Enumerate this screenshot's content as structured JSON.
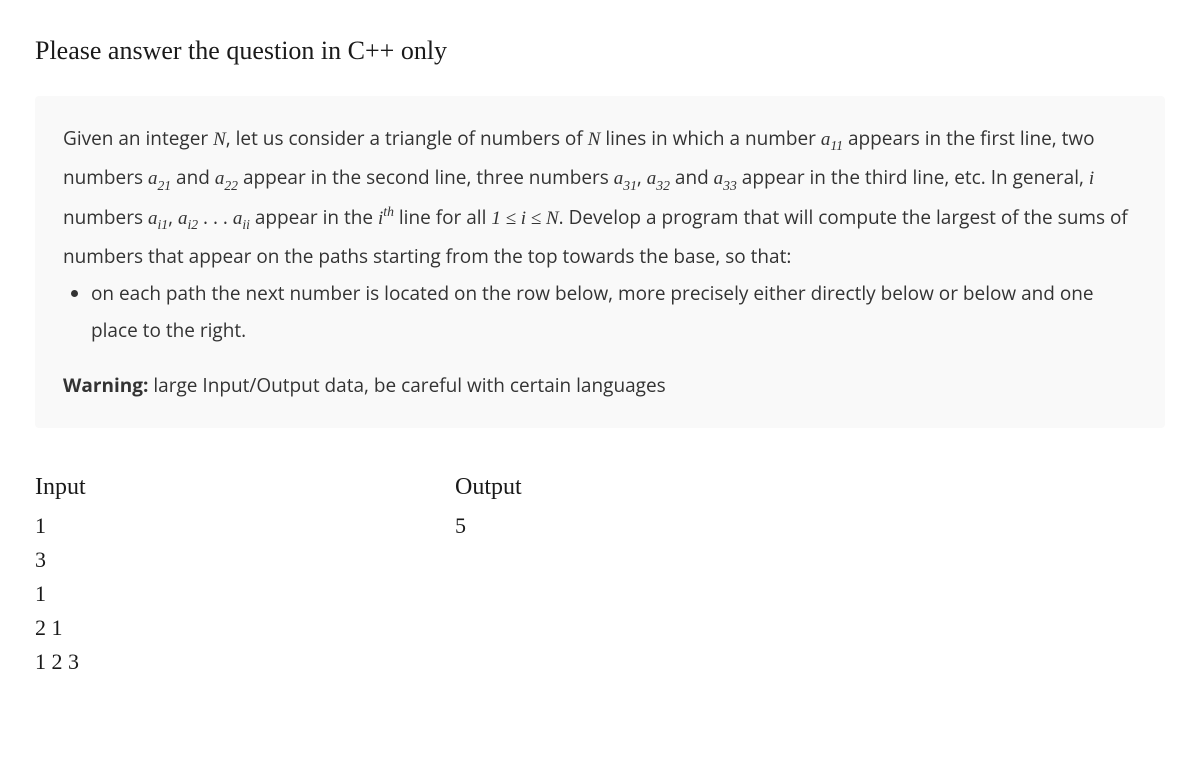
{
  "title": "Please answer the question in C++ only",
  "problem": {
    "p1_a": "Given an integer ",
    "N": "N",
    "p1_b": ", let us consider a triangle of numbers of ",
    "p1_c": " lines in which a number ",
    "a11": "a",
    "a11_sub": "11",
    "p1_d": " appears in the first line, two numbers ",
    "a21": "a",
    "a21_sub": "21",
    "p1_e": " and ",
    "a22": "a",
    "a22_sub": "22",
    "p1_f": " appear in the second line, three numbers ",
    "a31": "a",
    "a31_sub": "31",
    "p1_g": ", ",
    "a32": "a",
    "a32_sub": "32",
    "p1_h": " and ",
    "a33": "a",
    "a33_sub": "33",
    "p1_i": " appear in the third line, etc. In general, ",
    "i": "i",
    "p1_j": " numbers ",
    "ai1": "a",
    "ai1_sub": "i1",
    "p1_k": ", ",
    "ai2": "a",
    "ai2_sub": "i2",
    "p1_l": " . . . ",
    "aii": "a",
    "aii_sub": "ii",
    "p1_m": " appear in the ",
    "ith_i": "i",
    "ith_sup": "th",
    "p1_n": " line for all ",
    "range": "1 ≤ i ≤ N",
    "p1_o": ". Develop a program that will compute the largest of the sums of numbers that appear on the paths starting from the top towards the base, so that:",
    "bullet1": "on each path the next number is located on the row below, more precisely either directly below or below and one place to the right.",
    "warning_label": "Warning:",
    "warning_text": " large Input/Output data, be careful with certain languages"
  },
  "io": {
    "input_header": "Input",
    "output_header": "Output",
    "input_lines": "1\n3\n1\n2 1\n1 2 3",
    "output_lines": "5"
  }
}
